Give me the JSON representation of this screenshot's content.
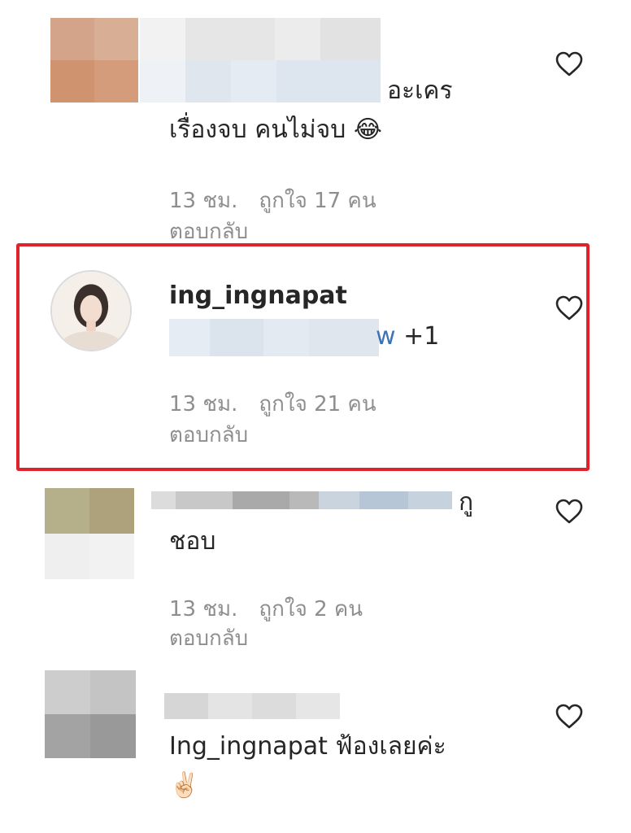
{
  "colors": {
    "highlight_border": "#e0222a",
    "meta_text": "#8e8e8e",
    "mention_blue": "#3f73b6"
  },
  "icons": {
    "like": "heart-outline"
  },
  "comments": [
    {
      "text_suffix": "อะเคร",
      "text_line2": "เรื่องจบ คนไม่จบ",
      "emoji": "😂",
      "time": "13 ชม.",
      "likes": "ถูกใจ 17 คน",
      "reply": "ตอบกลับ"
    },
    {
      "username": "ing_ingnapat",
      "mention_suffix": "w",
      "plus": "+1",
      "time": "13 ชม.",
      "likes": "ถูกใจ 21 คน",
      "reply": "ตอบกลับ"
    },
    {
      "text_suffix": "กู",
      "text_line2": "ชอบ",
      "time": "13 ชม.",
      "likes": "ถูกใจ 2 คน",
      "reply": "ตอบกลับ"
    },
    {
      "text": "Ing_ingnapat ฟ้องเลยค่ะ",
      "emoji": "✌🏻"
    }
  ]
}
